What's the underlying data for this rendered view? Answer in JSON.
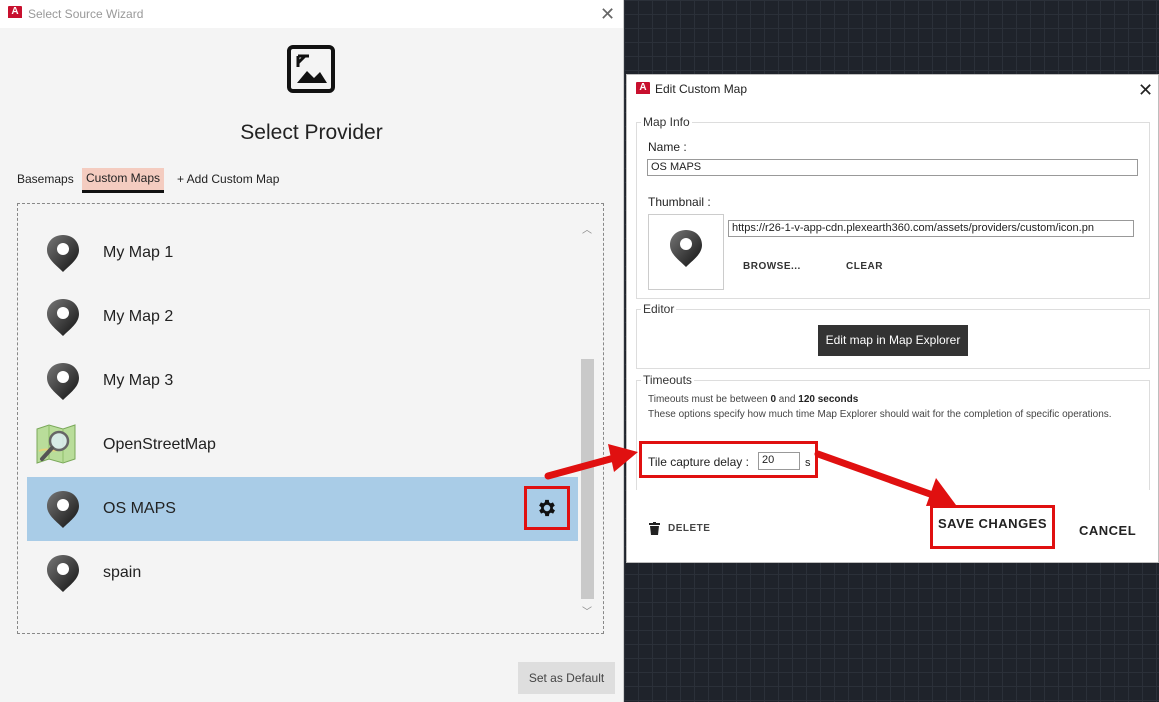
{
  "wizard": {
    "title": "Select Source Wizard",
    "heading": "Select Provider",
    "tabs": [
      {
        "label": "Basemaps"
      },
      {
        "label": "Custom Maps"
      },
      {
        "label": "+ Add Custom Map"
      }
    ],
    "active_tab": "Custom Maps",
    "items": [
      {
        "label": "My Map 1",
        "icon": "map-pin-icon"
      },
      {
        "label": "My Map 2",
        "icon": "map-pin-icon"
      },
      {
        "label": "My Map 3",
        "icon": "map-pin-icon"
      },
      {
        "label": "OpenStreetMap",
        "icon": "openstreetmap-icon"
      },
      {
        "label": "OS MAPS",
        "icon": "map-pin-icon",
        "selected": true
      },
      {
        "label": "spain",
        "icon": "map-pin-icon"
      }
    ],
    "set_default_label": "Set as Default"
  },
  "dialog": {
    "title": "Edit Custom Map",
    "map_info": {
      "group_label": "Map Info",
      "name_label": "Name :",
      "name_value": "OS MAPS",
      "thumbnail_label": "Thumbnail :",
      "thumbnail_url": "https://r26-1-v-app-cdn.plexearth360.com/assets/providers/custom/icon.pn",
      "browse_label": "BROWSE...",
      "clear_label": "CLEAR"
    },
    "editor": {
      "group_label": "Editor",
      "button_label": "Edit map in Map Explorer"
    },
    "timeouts": {
      "group_label": "Timeouts",
      "range_prefix": "Timeouts must be between ",
      "range_min": "0",
      "range_mid": " and ",
      "range_max": "120 seconds",
      "description": "These options specify how much time Map Explorer should wait for the completion of specific operations.",
      "tile_delay_label": "Tile capture delay :",
      "tile_delay_value": "20",
      "tile_delay_unit": "s"
    },
    "delete_label": "DELETE",
    "save_label": "SAVE CHANGES",
    "cancel_label": "CANCEL"
  },
  "colors": {
    "highlight": "#e01010",
    "selected_row": "#a9cce7",
    "active_tab": "#f4ccc0",
    "app_icon": "#c8102e"
  }
}
